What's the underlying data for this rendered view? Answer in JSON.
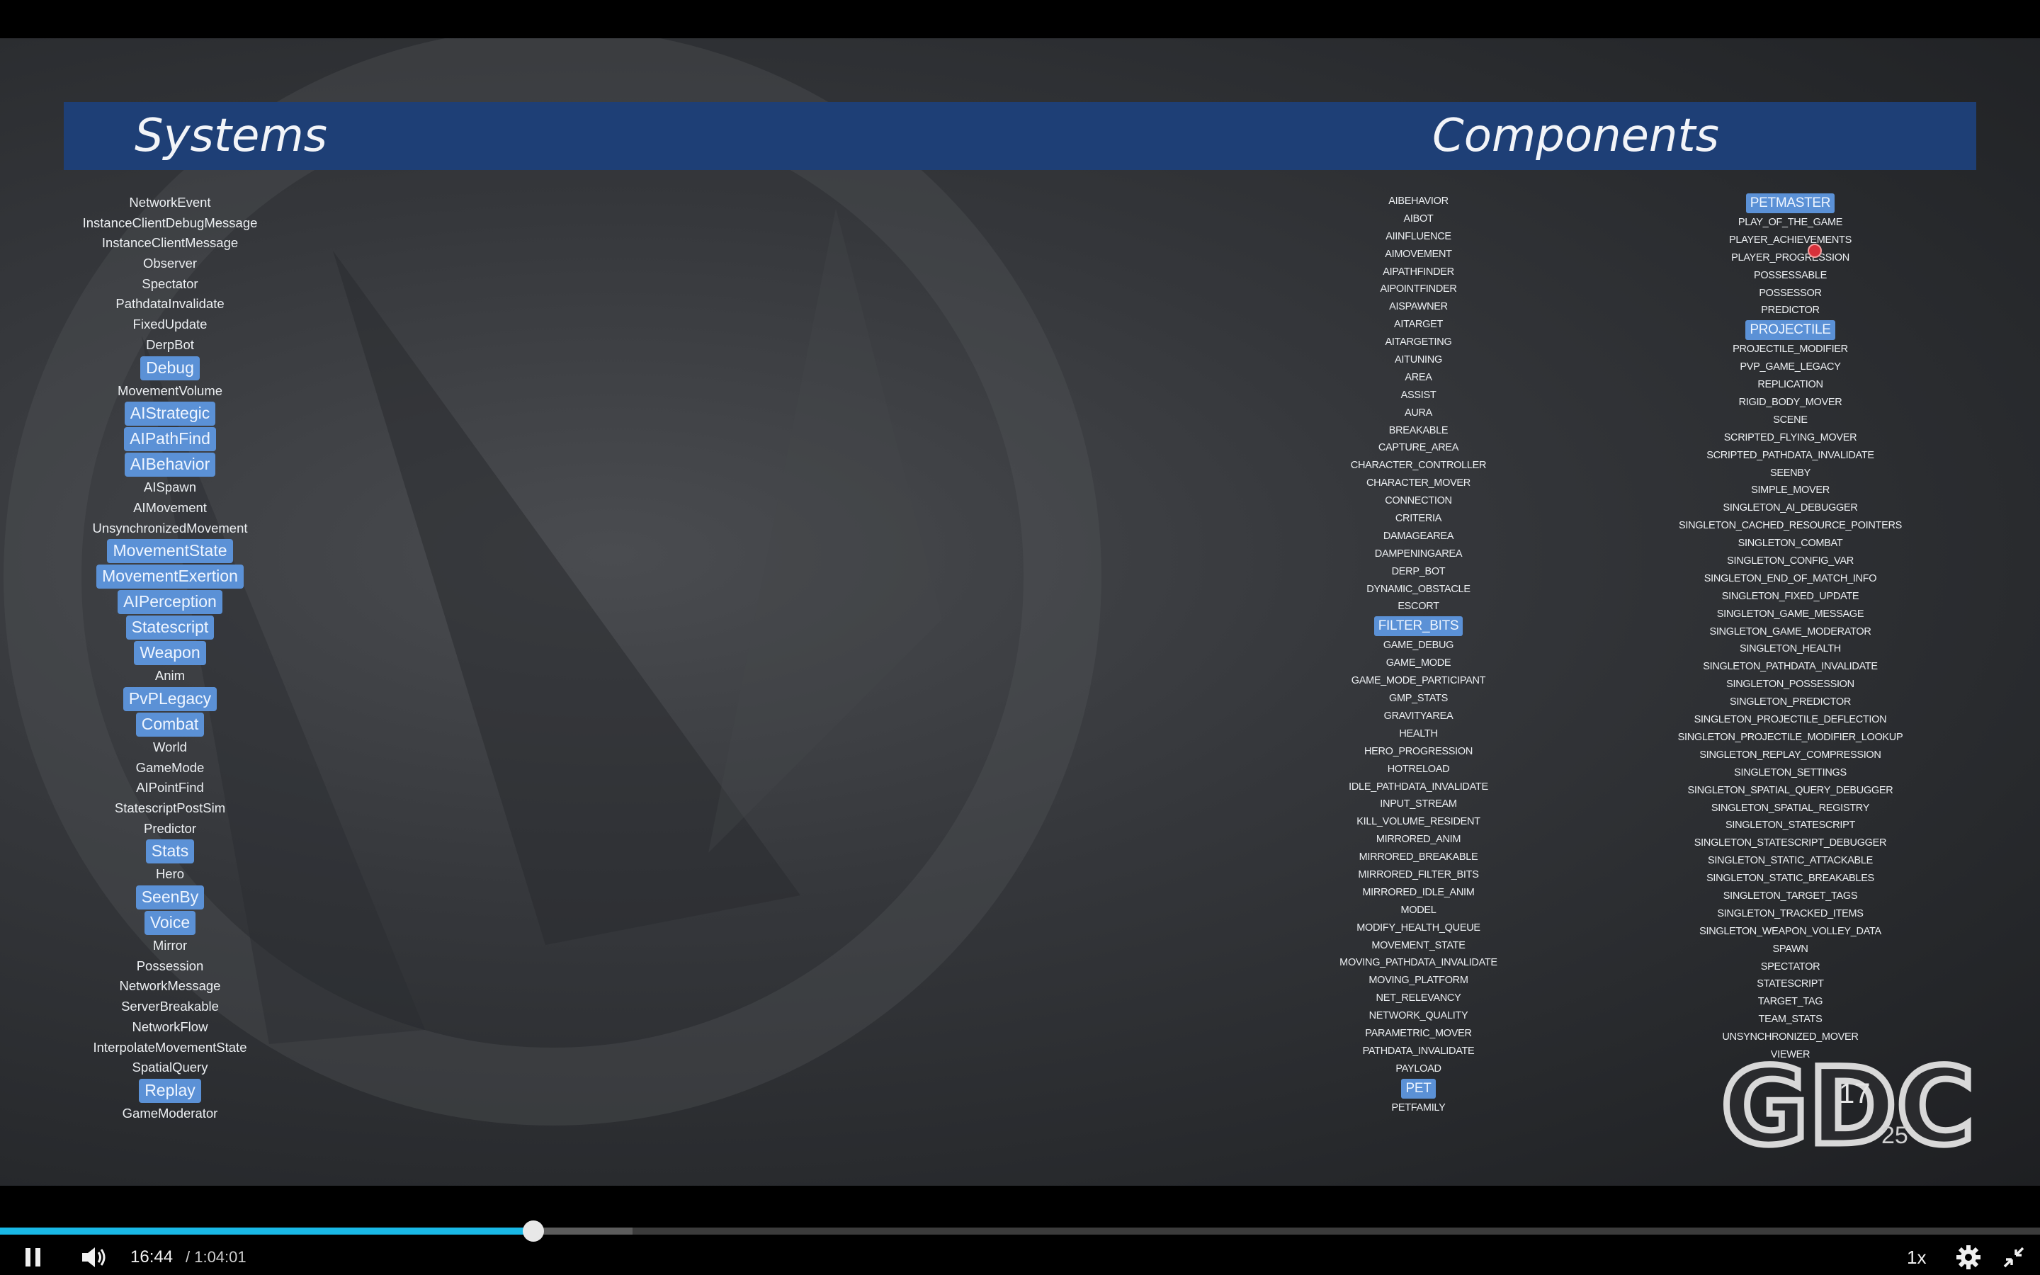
{
  "slide": {
    "systems_title": "Systems",
    "components_title": "Components",
    "systems": [
      {
        "label": "NetworkEvent",
        "hl": false
      },
      {
        "label": "InstanceClientDebugMessage",
        "hl": false
      },
      {
        "label": "InstanceClientMessage",
        "hl": false
      },
      {
        "label": "Observer",
        "hl": false
      },
      {
        "label": "Spectator",
        "hl": false
      },
      {
        "label": "PathdataInvalidate",
        "hl": false
      },
      {
        "label": "FixedUpdate",
        "hl": false
      },
      {
        "label": "DerpBot",
        "hl": false
      },
      {
        "label": "Debug",
        "hl": true
      },
      {
        "label": "MovementVolume",
        "hl": false
      },
      {
        "label": "AIStrategic",
        "hl": true
      },
      {
        "label": "AIPathFind",
        "hl": true
      },
      {
        "label": "AIBehavior",
        "hl": true
      },
      {
        "label": "AISpawn",
        "hl": false
      },
      {
        "label": "AIMovement",
        "hl": false
      },
      {
        "label": "UnsynchronizedMovement",
        "hl": false
      },
      {
        "label": "MovementState",
        "hl": true
      },
      {
        "label": "MovementExertion",
        "hl": true
      },
      {
        "label": "AIPerception",
        "hl": true
      },
      {
        "label": "Statescript",
        "hl": true
      },
      {
        "label": "Weapon",
        "hl": true
      },
      {
        "label": "Anim",
        "hl": false
      },
      {
        "label": "PvPLegacy",
        "hl": true
      },
      {
        "label": "Combat",
        "hl": true
      },
      {
        "label": "World",
        "hl": false
      },
      {
        "label": "GameMode",
        "hl": false
      },
      {
        "label": "AIPointFind",
        "hl": false
      },
      {
        "label": "StatescriptPostSim",
        "hl": false
      },
      {
        "label": "Predictor",
        "hl": false
      },
      {
        "label": "Stats",
        "hl": true
      },
      {
        "label": "Hero",
        "hl": false
      },
      {
        "label": "SeenBy",
        "hl": true
      },
      {
        "label": "Voice",
        "hl": true
      },
      {
        "label": "Mirror",
        "hl": false
      },
      {
        "label": "Possession",
        "hl": false
      },
      {
        "label": "NetworkMessage",
        "hl": false
      },
      {
        "label": "ServerBreakable",
        "hl": false
      },
      {
        "label": "NetworkFlow",
        "hl": false
      },
      {
        "label": "InterpolateMovementState",
        "hl": false
      },
      {
        "label": "SpatialQuery",
        "hl": false
      },
      {
        "label": "Replay",
        "hl": true
      },
      {
        "label": "GameModerator",
        "hl": false
      }
    ],
    "components_a": [
      {
        "label": "AIBEHAVIOR",
        "hl": false
      },
      {
        "label": "AIBOT",
        "hl": false
      },
      {
        "label": "AIINFLUENCE",
        "hl": false
      },
      {
        "label": "AIMOVEMENT",
        "hl": false
      },
      {
        "label": "AIPATHFINDER",
        "hl": false
      },
      {
        "label": "AIPOINTFINDER",
        "hl": false
      },
      {
        "label": "AISPAWNER",
        "hl": false
      },
      {
        "label": "AITARGET",
        "hl": false
      },
      {
        "label": "AITARGETING",
        "hl": false
      },
      {
        "label": "AITUNING",
        "hl": false
      },
      {
        "label": "AREA",
        "hl": false
      },
      {
        "label": "ASSIST",
        "hl": false
      },
      {
        "label": "AURA",
        "hl": false
      },
      {
        "label": "BREAKABLE",
        "hl": false
      },
      {
        "label": "CAPTURE_AREA",
        "hl": false
      },
      {
        "label": "CHARACTER_CONTROLLER",
        "hl": false
      },
      {
        "label": "CHARACTER_MOVER",
        "hl": false
      },
      {
        "label": "CONNECTION",
        "hl": false
      },
      {
        "label": "CRITERIA",
        "hl": false
      },
      {
        "label": "DAMAGEAREA",
        "hl": false
      },
      {
        "label": "DAMPENINGAREA",
        "hl": false
      },
      {
        "label": "DERP_BOT",
        "hl": false
      },
      {
        "label": "DYNAMIC_OBSTACLE",
        "hl": false
      },
      {
        "label": "ESCORT",
        "hl": false
      },
      {
        "label": "FILTER_BITS",
        "hl": true
      },
      {
        "label": "GAME_DEBUG",
        "hl": false
      },
      {
        "label": "GAME_MODE",
        "hl": false
      },
      {
        "label": "GAME_MODE_PARTICIPANT",
        "hl": false
      },
      {
        "label": "GMP_STATS",
        "hl": false
      },
      {
        "label": "GRAVITYAREA",
        "hl": false
      },
      {
        "label": "HEALTH",
        "hl": false
      },
      {
        "label": "HERO_PROGRESSION",
        "hl": false
      },
      {
        "label": "HOTRELOAD",
        "hl": false
      },
      {
        "label": "IDLE_PATHDATA_INVALIDATE",
        "hl": false
      },
      {
        "label": "INPUT_STREAM",
        "hl": false
      },
      {
        "label": "KILL_VOLUME_RESIDENT",
        "hl": false
      },
      {
        "label": "MIRRORED_ANIM",
        "hl": false
      },
      {
        "label": "MIRRORED_BREAKABLE",
        "hl": false
      },
      {
        "label": "MIRRORED_FILTER_BITS",
        "hl": false
      },
      {
        "label": "MIRRORED_IDLE_ANIM",
        "hl": false
      },
      {
        "label": "MODEL",
        "hl": false
      },
      {
        "label": "MODIFY_HEALTH_QUEUE",
        "hl": false
      },
      {
        "label": "MOVEMENT_STATE",
        "hl": false
      },
      {
        "label": "MOVING_PATHDATA_INVALIDATE",
        "hl": false
      },
      {
        "label": "MOVING_PLATFORM",
        "hl": false
      },
      {
        "label": "NET_RELEVANCY",
        "hl": false
      },
      {
        "label": "NETWORK_QUALITY",
        "hl": false
      },
      {
        "label": "PARAMETRIC_MOVER",
        "hl": false
      },
      {
        "label": "PATHDATA_INVALIDATE",
        "hl": false
      },
      {
        "label": "PAYLOAD",
        "hl": false
      },
      {
        "label": "PET",
        "hl": true
      },
      {
        "label": "PETFAMILY",
        "hl": false
      }
    ],
    "components_b": [
      {
        "label": "PETMASTER",
        "hl": true
      },
      {
        "label": "PLAY_OF_THE_GAME",
        "hl": false
      },
      {
        "label": "PLAYER_ACHIEVEMENTS",
        "hl": false
      },
      {
        "label": "PLAYER_PROGRESSION",
        "hl": false
      },
      {
        "label": "POSSESSABLE",
        "hl": false
      },
      {
        "label": "POSSESSOR",
        "hl": false
      },
      {
        "label": "PREDICTOR",
        "hl": false
      },
      {
        "label": "PROJECTILE",
        "hl": true
      },
      {
        "label": "PROJECTILE_MODIFIER",
        "hl": false
      },
      {
        "label": "PVP_GAME_LEGACY",
        "hl": false
      },
      {
        "label": "REPLICATION",
        "hl": false
      },
      {
        "label": "RIGID_BODY_MOVER",
        "hl": false
      },
      {
        "label": "SCENE",
        "hl": false
      },
      {
        "label": "SCRIPTED_FLYING_MOVER",
        "hl": false
      },
      {
        "label": "SCRIPTED_PATHDATA_INVALIDATE",
        "hl": false
      },
      {
        "label": "SEENBY",
        "hl": false
      },
      {
        "label": "SIMPLE_MOVER",
        "hl": false
      },
      {
        "label": "SINGLETON_AI_DEBUGGER",
        "hl": false
      },
      {
        "label": "SINGLETON_CACHED_RESOURCE_POINTERS",
        "hl": false
      },
      {
        "label": "SINGLETON_COMBAT",
        "hl": false
      },
      {
        "label": "SINGLETON_CONFIG_VAR",
        "hl": false
      },
      {
        "label": "SINGLETON_END_OF_MATCH_INFO",
        "hl": false
      },
      {
        "label": "SINGLETON_FIXED_UPDATE",
        "hl": false
      },
      {
        "label": "SINGLETON_GAME_MESSAGE",
        "hl": false
      },
      {
        "label": "SINGLETON_GAME_MODERATOR",
        "hl": false
      },
      {
        "label": "SINGLETON_HEALTH",
        "hl": false
      },
      {
        "label": "SINGLETON_PATHDATA_INVALIDATE",
        "hl": false
      },
      {
        "label": "SINGLETON_POSSESSION",
        "hl": false
      },
      {
        "label": "SINGLETON_PREDICTOR",
        "hl": false
      },
      {
        "label": "SINGLETON_PROJECTILE_DEFLECTION",
        "hl": false
      },
      {
        "label": "SINGLETON_PROJECTILE_MODIFIER_LOOKUP",
        "hl": false
      },
      {
        "label": "SINGLETON_REPLAY_COMPRESSION",
        "hl": false
      },
      {
        "label": "SINGLETON_SETTINGS",
        "hl": false
      },
      {
        "label": "SINGLETON_SPATIAL_QUERY_DEBUGGER",
        "hl": false
      },
      {
        "label": "SINGLETON_SPATIAL_REGISTRY",
        "hl": false
      },
      {
        "label": "SINGLETON_STATESCRIPT",
        "hl": false
      },
      {
        "label": "SINGLETON_STATESCRIPT_DEBUGGER",
        "hl": false
      },
      {
        "label": "SINGLETON_STATIC_ATTACKABLE",
        "hl": false
      },
      {
        "label": "SINGLETON_STATIC_BREAKABLES",
        "hl": false
      },
      {
        "label": "SINGLETON_TARGET_TAGS",
        "hl": false
      },
      {
        "label": "SINGLETON_TRACKED_ITEMS",
        "hl": false
      },
      {
        "label": "SINGLETON_WEAPON_VOLLEY_DATA",
        "hl": false
      },
      {
        "label": "SPAWN",
        "hl": false
      },
      {
        "label": "SPECTATOR",
        "hl": false
      },
      {
        "label": "STATESCRIPT",
        "hl": false
      },
      {
        "label": "TARGET_TAG",
        "hl": false
      },
      {
        "label": "TEAM_STATS",
        "hl": false
      },
      {
        "label": "UNSYNCHRONIZED_MOVER",
        "hl": false
      },
      {
        "label": "VIEWER",
        "hl": false
      }
    ],
    "gdc_logo": {
      "text": "GDC",
      "year": "17",
      "anniversary": "25"
    }
  },
  "player": {
    "current_time": "16:44",
    "duration": "/ 1:04:01",
    "speed": "1x",
    "progress_fraction": 0.2615,
    "buffered_fraction": 0.31,
    "accent_color": "#19b8e6",
    "icons": {
      "play_pause": "pause-icon",
      "volume": "speaker-icon",
      "settings": "gear-icon",
      "fullscreen": "exit-fullscreen-icon"
    }
  }
}
